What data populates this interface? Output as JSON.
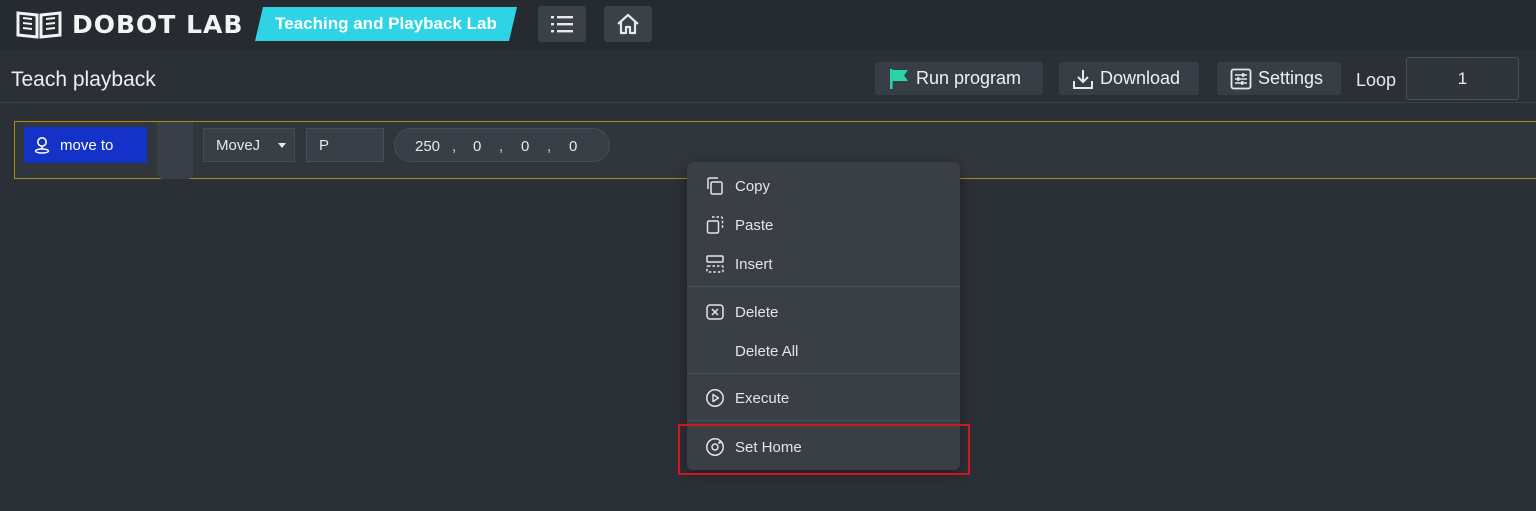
{
  "header": {
    "logo_text": "DOBOT LAB",
    "lab_title": "Teaching and Playback Lab",
    "menu_icon": "list-icon",
    "home_icon": "home-icon"
  },
  "toolbar": {
    "page_title": "Teach playback",
    "run_label": "Run program",
    "download_label": "Download",
    "settings_label": "Settings",
    "loop_label": "Loop",
    "loop_value": "1"
  },
  "block": {
    "label": "move to",
    "mode": "MoveJ",
    "point": "P",
    "coords": [
      "250",
      "0",
      "0",
      "0"
    ]
  },
  "context_menu": {
    "copy": "Copy",
    "paste": "Paste",
    "insert": "Insert",
    "delete": "Delete",
    "delete_all": "Delete All",
    "execute": "Execute",
    "set_home": "Set Home"
  },
  "colors": {
    "accent": "#2ed3e6",
    "block_blue": "#1432c8",
    "run_flag": "#2bd3a6",
    "highlight": "#d0171c"
  }
}
